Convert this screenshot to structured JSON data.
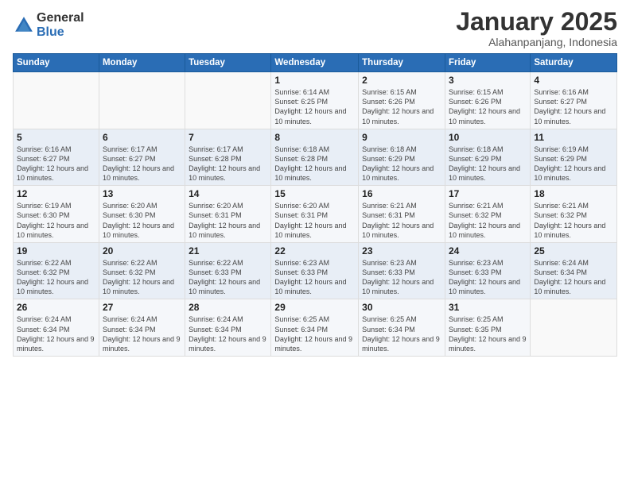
{
  "logo": {
    "general": "General",
    "blue": "Blue"
  },
  "header": {
    "month": "January 2025",
    "location": "Alahanpanjang, Indonesia"
  },
  "weekdays": [
    "Sunday",
    "Monday",
    "Tuesday",
    "Wednesday",
    "Thursday",
    "Friday",
    "Saturday"
  ],
  "weeks": [
    [
      {
        "day": "",
        "sunrise": "",
        "sunset": "",
        "daylight": ""
      },
      {
        "day": "",
        "sunrise": "",
        "sunset": "",
        "daylight": ""
      },
      {
        "day": "",
        "sunrise": "",
        "sunset": "",
        "daylight": ""
      },
      {
        "day": "1",
        "sunrise": "Sunrise: 6:14 AM",
        "sunset": "Sunset: 6:25 PM",
        "daylight": "Daylight: 12 hours and 10 minutes."
      },
      {
        "day": "2",
        "sunrise": "Sunrise: 6:15 AM",
        "sunset": "Sunset: 6:26 PM",
        "daylight": "Daylight: 12 hours and 10 minutes."
      },
      {
        "day": "3",
        "sunrise": "Sunrise: 6:15 AM",
        "sunset": "Sunset: 6:26 PM",
        "daylight": "Daylight: 12 hours and 10 minutes."
      },
      {
        "day": "4",
        "sunrise": "Sunrise: 6:16 AM",
        "sunset": "Sunset: 6:27 PM",
        "daylight": "Daylight: 12 hours and 10 minutes."
      }
    ],
    [
      {
        "day": "5",
        "sunrise": "Sunrise: 6:16 AM",
        "sunset": "Sunset: 6:27 PM",
        "daylight": "Daylight: 12 hours and 10 minutes."
      },
      {
        "day": "6",
        "sunrise": "Sunrise: 6:17 AM",
        "sunset": "Sunset: 6:27 PM",
        "daylight": "Daylight: 12 hours and 10 minutes."
      },
      {
        "day": "7",
        "sunrise": "Sunrise: 6:17 AM",
        "sunset": "Sunset: 6:28 PM",
        "daylight": "Daylight: 12 hours and 10 minutes."
      },
      {
        "day": "8",
        "sunrise": "Sunrise: 6:18 AM",
        "sunset": "Sunset: 6:28 PM",
        "daylight": "Daylight: 12 hours and 10 minutes."
      },
      {
        "day": "9",
        "sunrise": "Sunrise: 6:18 AM",
        "sunset": "Sunset: 6:29 PM",
        "daylight": "Daylight: 12 hours and 10 minutes."
      },
      {
        "day": "10",
        "sunrise": "Sunrise: 6:18 AM",
        "sunset": "Sunset: 6:29 PM",
        "daylight": "Daylight: 12 hours and 10 minutes."
      },
      {
        "day": "11",
        "sunrise": "Sunrise: 6:19 AM",
        "sunset": "Sunset: 6:29 PM",
        "daylight": "Daylight: 12 hours and 10 minutes."
      }
    ],
    [
      {
        "day": "12",
        "sunrise": "Sunrise: 6:19 AM",
        "sunset": "Sunset: 6:30 PM",
        "daylight": "Daylight: 12 hours and 10 minutes."
      },
      {
        "day": "13",
        "sunrise": "Sunrise: 6:20 AM",
        "sunset": "Sunset: 6:30 PM",
        "daylight": "Daylight: 12 hours and 10 minutes."
      },
      {
        "day": "14",
        "sunrise": "Sunrise: 6:20 AM",
        "sunset": "Sunset: 6:31 PM",
        "daylight": "Daylight: 12 hours and 10 minutes."
      },
      {
        "day": "15",
        "sunrise": "Sunrise: 6:20 AM",
        "sunset": "Sunset: 6:31 PM",
        "daylight": "Daylight: 12 hours and 10 minutes."
      },
      {
        "day": "16",
        "sunrise": "Sunrise: 6:21 AM",
        "sunset": "Sunset: 6:31 PM",
        "daylight": "Daylight: 12 hours and 10 minutes."
      },
      {
        "day": "17",
        "sunrise": "Sunrise: 6:21 AM",
        "sunset": "Sunset: 6:32 PM",
        "daylight": "Daylight: 12 hours and 10 minutes."
      },
      {
        "day": "18",
        "sunrise": "Sunrise: 6:21 AM",
        "sunset": "Sunset: 6:32 PM",
        "daylight": "Daylight: 12 hours and 10 minutes."
      }
    ],
    [
      {
        "day": "19",
        "sunrise": "Sunrise: 6:22 AM",
        "sunset": "Sunset: 6:32 PM",
        "daylight": "Daylight: 12 hours and 10 minutes."
      },
      {
        "day": "20",
        "sunrise": "Sunrise: 6:22 AM",
        "sunset": "Sunset: 6:32 PM",
        "daylight": "Daylight: 12 hours and 10 minutes."
      },
      {
        "day": "21",
        "sunrise": "Sunrise: 6:22 AM",
        "sunset": "Sunset: 6:33 PM",
        "daylight": "Daylight: 12 hours and 10 minutes."
      },
      {
        "day": "22",
        "sunrise": "Sunrise: 6:23 AM",
        "sunset": "Sunset: 6:33 PM",
        "daylight": "Daylight: 12 hours and 10 minutes."
      },
      {
        "day": "23",
        "sunrise": "Sunrise: 6:23 AM",
        "sunset": "Sunset: 6:33 PM",
        "daylight": "Daylight: 12 hours and 10 minutes."
      },
      {
        "day": "24",
        "sunrise": "Sunrise: 6:23 AM",
        "sunset": "Sunset: 6:33 PM",
        "daylight": "Daylight: 12 hours and 10 minutes."
      },
      {
        "day": "25",
        "sunrise": "Sunrise: 6:24 AM",
        "sunset": "Sunset: 6:34 PM",
        "daylight": "Daylight: 12 hours and 10 minutes."
      }
    ],
    [
      {
        "day": "26",
        "sunrise": "Sunrise: 6:24 AM",
        "sunset": "Sunset: 6:34 PM",
        "daylight": "Daylight: 12 hours and 9 minutes."
      },
      {
        "day": "27",
        "sunrise": "Sunrise: 6:24 AM",
        "sunset": "Sunset: 6:34 PM",
        "daylight": "Daylight: 12 hours and 9 minutes."
      },
      {
        "day": "28",
        "sunrise": "Sunrise: 6:24 AM",
        "sunset": "Sunset: 6:34 PM",
        "daylight": "Daylight: 12 hours and 9 minutes."
      },
      {
        "day": "29",
        "sunrise": "Sunrise: 6:25 AM",
        "sunset": "Sunset: 6:34 PM",
        "daylight": "Daylight: 12 hours and 9 minutes."
      },
      {
        "day": "30",
        "sunrise": "Sunrise: 6:25 AM",
        "sunset": "Sunset: 6:34 PM",
        "daylight": "Daylight: 12 hours and 9 minutes."
      },
      {
        "day": "31",
        "sunrise": "Sunrise: 6:25 AM",
        "sunset": "Sunset: 6:35 PM",
        "daylight": "Daylight: 12 hours and 9 minutes."
      },
      {
        "day": "",
        "sunrise": "",
        "sunset": "",
        "daylight": ""
      }
    ]
  ]
}
